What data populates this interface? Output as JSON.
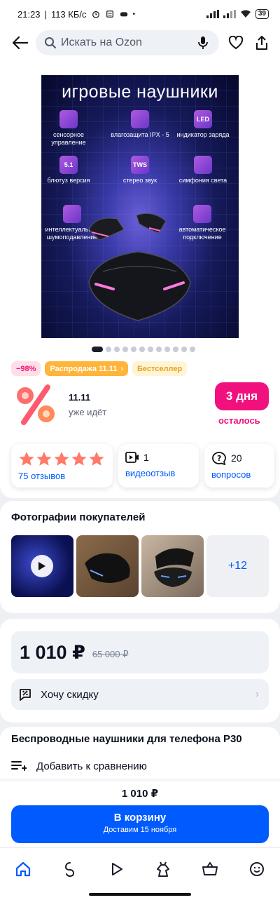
{
  "status_bar": {
    "time": "21:23",
    "speed": "113 КБ/с",
    "battery": "39"
  },
  "top_bar": {
    "search_placeholder": "Искать на Ozon"
  },
  "hero": {
    "title": "игровые наушники",
    "features": [
      "сенсорное управление",
      "влагозащита IPX - 5",
      "индикатор заряда",
      "блютуз версия",
      "стерео звук",
      "симфония света",
      "интеллектуальное шумоподавление",
      "автоматическое подключение"
    ],
    "feature_icons": [
      "",
      "",
      "LED",
      "5.1",
      "TWS",
      "",
      "",
      ""
    ]
  },
  "gallery": {
    "count": 12,
    "active_index": 0
  },
  "badges": {
    "discount": "−98%",
    "sale": "Распродажа 11.11",
    "bestseller": "Бестселлер"
  },
  "promo": {
    "title": "11.11",
    "subtitle": "уже идёт",
    "timer": "3 дня",
    "timer_sub": "осталось"
  },
  "stats": {
    "rating": 5,
    "reviews_label": "75 отзывов",
    "video_count": "1",
    "video_label": "видеоотзыв",
    "questions_count": "20",
    "questions_label": "вопросов"
  },
  "photos": {
    "title": "Фотографии покупателей",
    "more_label": "+12"
  },
  "price": {
    "current": "1 010 ₽",
    "old": "65 000 ₽",
    "discount_label": "Хочу скидку"
  },
  "product": {
    "title": "Беспроводные наушники для телефона P30",
    "compare_label": "Добавить к сравнению"
  },
  "cart": {
    "price": "1 010 ₽",
    "button": "В корзину",
    "delivery": "Доставим 15 ноября"
  },
  "colors": {
    "accent": "#005bff",
    "pink": "#f1117e",
    "orange": "#ffb43a"
  }
}
